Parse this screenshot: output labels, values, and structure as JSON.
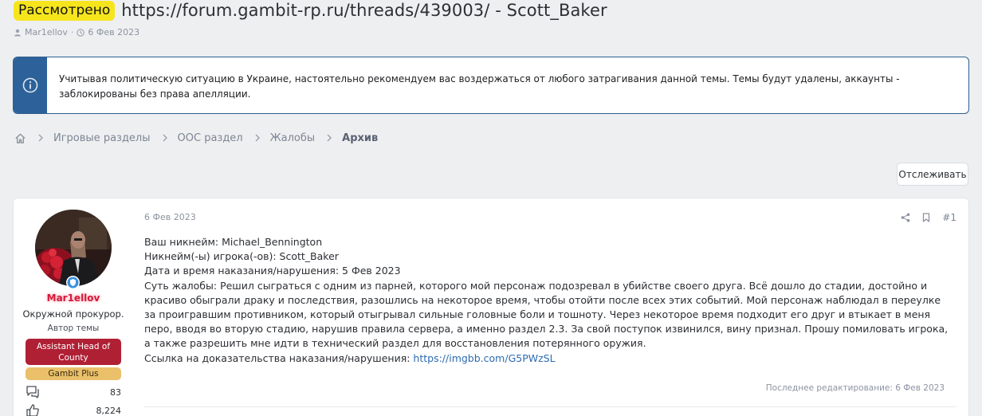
{
  "thread": {
    "prefix": "Рассмотрено",
    "title": "https://forum.gambit-rp.ru/threads/439003/ - Scott_Baker",
    "author": "Mar1ellov",
    "date": "6 Фев 2023"
  },
  "notice": {
    "text": "Учитывая политическую ситуацию в Украине, настоятельно рекомендуем вас воздержаться от любого затрагивания данной темы. Темы будут удалены, аккаунты - заблокированы без права апелляции."
  },
  "breadcrumb": {
    "items": [
      "Игровые разделы",
      "ООС раздел",
      "Жалобы",
      "Архив"
    ]
  },
  "follow_label": "Отслеживать",
  "post": {
    "date": "6 Фев 2023",
    "number": "#1",
    "user": {
      "name": "Mar1ellov",
      "title": "Окружной прокурор.",
      "role": "Автор темы",
      "banner_primary": "Assistant Head of County",
      "banner_secondary": "Gambit Plus",
      "messages": "83",
      "reactions": "8,224"
    },
    "lines": [
      "Ваш никнейм: Michael_Bennington",
      "Никнейм(-ы) игрока(-ов): Scott_Baker",
      "Дата и время наказания/нарушения: 5 Фев 2023",
      "Суть жалобы: Решил сыграться с одним из парней, которого мой персонаж подозревал в убийстве своего друга. Всё дошло до стадии, достойно и красиво обыграли драку и последствия, разошлись на некоторое время, чтобы отойти после всех этих событий. Мой персонаж наблюдал в переулке за проигравшим противником, который отыгрывал сильные головные боли и тошноту. Через некоторое время подходит его друг и втыкает в меня перо, вводя во вторую стадию, нарушив правила сервера, а именно раздел 2.3. За свой поступок извинился, вину признал. Прошу помиловать игрока, а также разрешить мне идти в технический раздел для восстановления потерянного оружия."
    ],
    "evidence_label": "Ссылка на доказательства наказания/нарушения: ",
    "evidence_link": "https://imgbb.com/G5PWzSL",
    "last_edit": "Последнее редактирование: 6 Фев 2023"
  },
  "colors": {
    "prefix_bg": "#f6e51d",
    "notice_accent": "#2c6199",
    "username": "#d51a3b",
    "banner_red": "#b02035",
    "banner_gold": "#eac06a",
    "link": "#2c6bb0"
  },
  "icons": [
    "user-icon",
    "clock-icon",
    "info-icon",
    "home-icon",
    "chevron-right-icon",
    "share-icon",
    "bookmark-icon",
    "messages-icon",
    "like-icon",
    "shield-badge-icon"
  ]
}
